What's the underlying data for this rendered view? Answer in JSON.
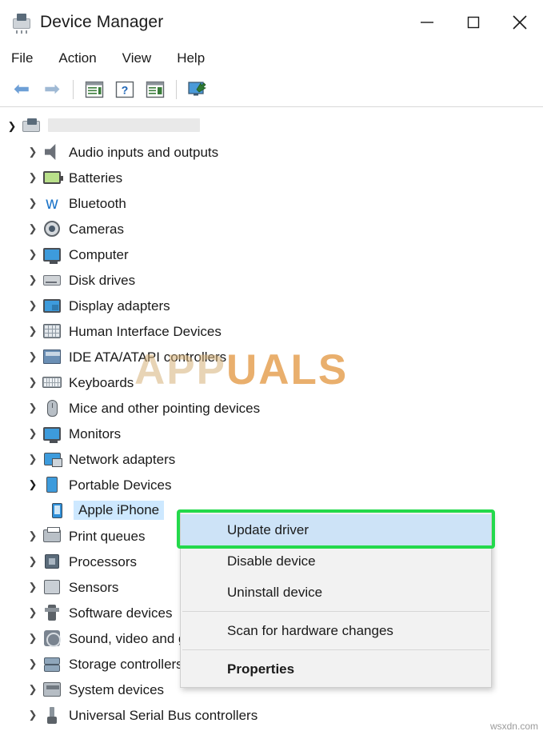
{
  "window": {
    "title": "Device Manager",
    "icon": "device-manager-icon",
    "controls": {
      "minimize": "–",
      "maximize": "□",
      "close": "✕"
    }
  },
  "menubar": [
    {
      "label": "File"
    },
    {
      "label": "Action"
    },
    {
      "label": "View"
    },
    {
      "label": "Help"
    }
  ],
  "toolbar": [
    {
      "name": "back-button",
      "glyph": "⟵"
    },
    {
      "name": "forward-button",
      "glyph": "⟶"
    },
    {
      "name": "properties-button",
      "glyph": "properties-icon"
    },
    {
      "name": "help-button",
      "glyph": "?"
    },
    {
      "name": "scan-hardware-button",
      "glyph": "scan-icon"
    },
    {
      "name": "update-driver-button",
      "glyph": "update-driver-icon"
    }
  ],
  "tree": {
    "root": {
      "label": "",
      "redacted": true,
      "expanded": true
    },
    "items": [
      {
        "label": "Audio inputs and outputs",
        "icon": "speaker-icon",
        "expanded": false
      },
      {
        "label": "Batteries",
        "icon": "battery-icon",
        "expanded": false
      },
      {
        "label": "Bluetooth",
        "icon": "bluetooth-icon",
        "expanded": false
      },
      {
        "label": "Cameras",
        "icon": "camera-icon",
        "expanded": false
      },
      {
        "label": "Computer",
        "icon": "computer-icon",
        "expanded": false
      },
      {
        "label": "Disk drives",
        "icon": "disk-drive-icon",
        "expanded": false
      },
      {
        "label": "Display adapters",
        "icon": "display-adapter-icon",
        "expanded": false
      },
      {
        "label": "Human Interface Devices",
        "icon": "hid-icon",
        "expanded": false
      },
      {
        "label": "IDE ATA/ATAPI controllers",
        "icon": "ide-controller-icon",
        "expanded": false
      },
      {
        "label": "Keyboards",
        "icon": "keyboard-icon",
        "expanded": false
      },
      {
        "label": "Mice and other pointing devices",
        "icon": "mouse-icon",
        "expanded": false
      },
      {
        "label": "Monitors",
        "icon": "monitor-icon",
        "expanded": false
      },
      {
        "label": "Network adapters",
        "icon": "network-adapter-icon",
        "expanded": false
      },
      {
        "label": "Portable Devices",
        "icon": "portable-device-icon",
        "expanded": true
      },
      {
        "label": "Apple iPhone",
        "icon": "iphone-icon",
        "child": true,
        "selected": true
      },
      {
        "label": "Print queues",
        "icon": "printer-icon",
        "expanded": false
      },
      {
        "label": "Processors",
        "icon": "processor-icon",
        "expanded": false
      },
      {
        "label": "Sensors",
        "icon": "sensor-icon",
        "expanded": false
      },
      {
        "label": "Software devices",
        "icon": "software-device-icon",
        "expanded": false
      },
      {
        "label": "Sound, video and game controllers",
        "icon": "sound-icon",
        "expanded": false
      },
      {
        "label": "Storage controllers",
        "icon": "storage-controller-icon",
        "expanded": false
      },
      {
        "label": "System devices",
        "icon": "system-device-icon",
        "expanded": false
      },
      {
        "label": "Universal Serial Bus controllers",
        "icon": "usb-controller-icon",
        "expanded": false
      }
    ]
  },
  "context_menu": {
    "items": [
      {
        "label": "Update driver",
        "highlighted": true,
        "bold": false
      },
      {
        "label": "Disable device",
        "highlighted": false,
        "bold": false
      },
      {
        "label": "Uninstall device",
        "highlighted": false,
        "bold": false
      },
      {
        "label": "Scan for hardware changes",
        "highlighted": false,
        "bold": false
      },
      {
        "label": "Properties",
        "highlighted": false,
        "bold": true
      }
    ],
    "highlight_color": "#23d94b",
    "selected_color": "#cde3f7"
  },
  "watermark": {
    "text_a": "APP",
    "text_b": "UALS"
  },
  "credit": "wsxdn.com"
}
